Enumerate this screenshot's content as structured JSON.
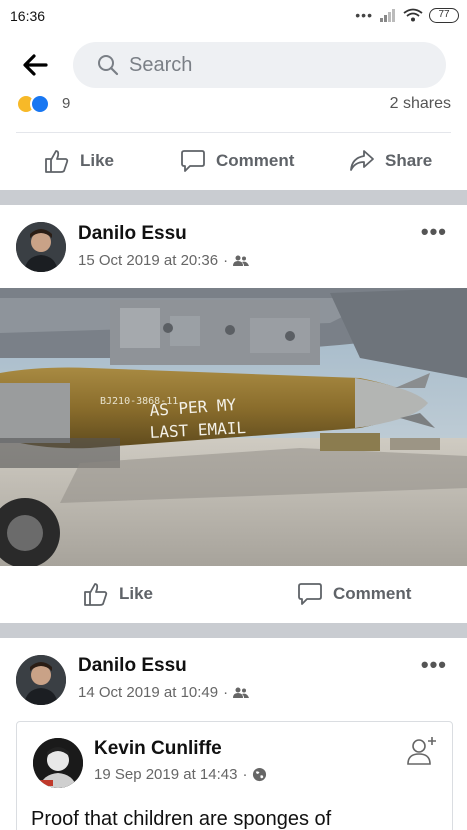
{
  "status_bar": {
    "time": "16:36",
    "battery": "77"
  },
  "search": {
    "placeholder": "Search"
  },
  "prev_post": {
    "reaction_count": "9",
    "shares": "2 shares",
    "actions": {
      "like": "Like",
      "comment": "Comment",
      "share": "Share"
    }
  },
  "post1": {
    "author": "Danilo Essu",
    "date": "15 Oct 2019 at 20:36",
    "audience_icon": "friends-icon",
    "image_text": {
      "stencil": "BJ210-3868-11",
      "line1": "AS PER MY",
      "line2": "LAST EMAIL"
    },
    "actions": {
      "like": "Like",
      "comment": "Comment"
    }
  },
  "post2": {
    "author": "Danilo Essu",
    "date": "14 Oct 2019 at 10:49",
    "audience_icon": "friends-icon",
    "shared": {
      "author": "Kevin Cunliffe",
      "date": "19 Sep 2019 at 14:43",
      "audience_icon": "globe-icon",
      "text": "Proof that children are sponges of"
    }
  },
  "colors": {
    "separator": "#c9ccd1",
    "search_bg": "#eef0f3",
    "action_text": "#5f6368",
    "like_blue": "#1877f2",
    "haha_yellow": "#f7b928"
  }
}
